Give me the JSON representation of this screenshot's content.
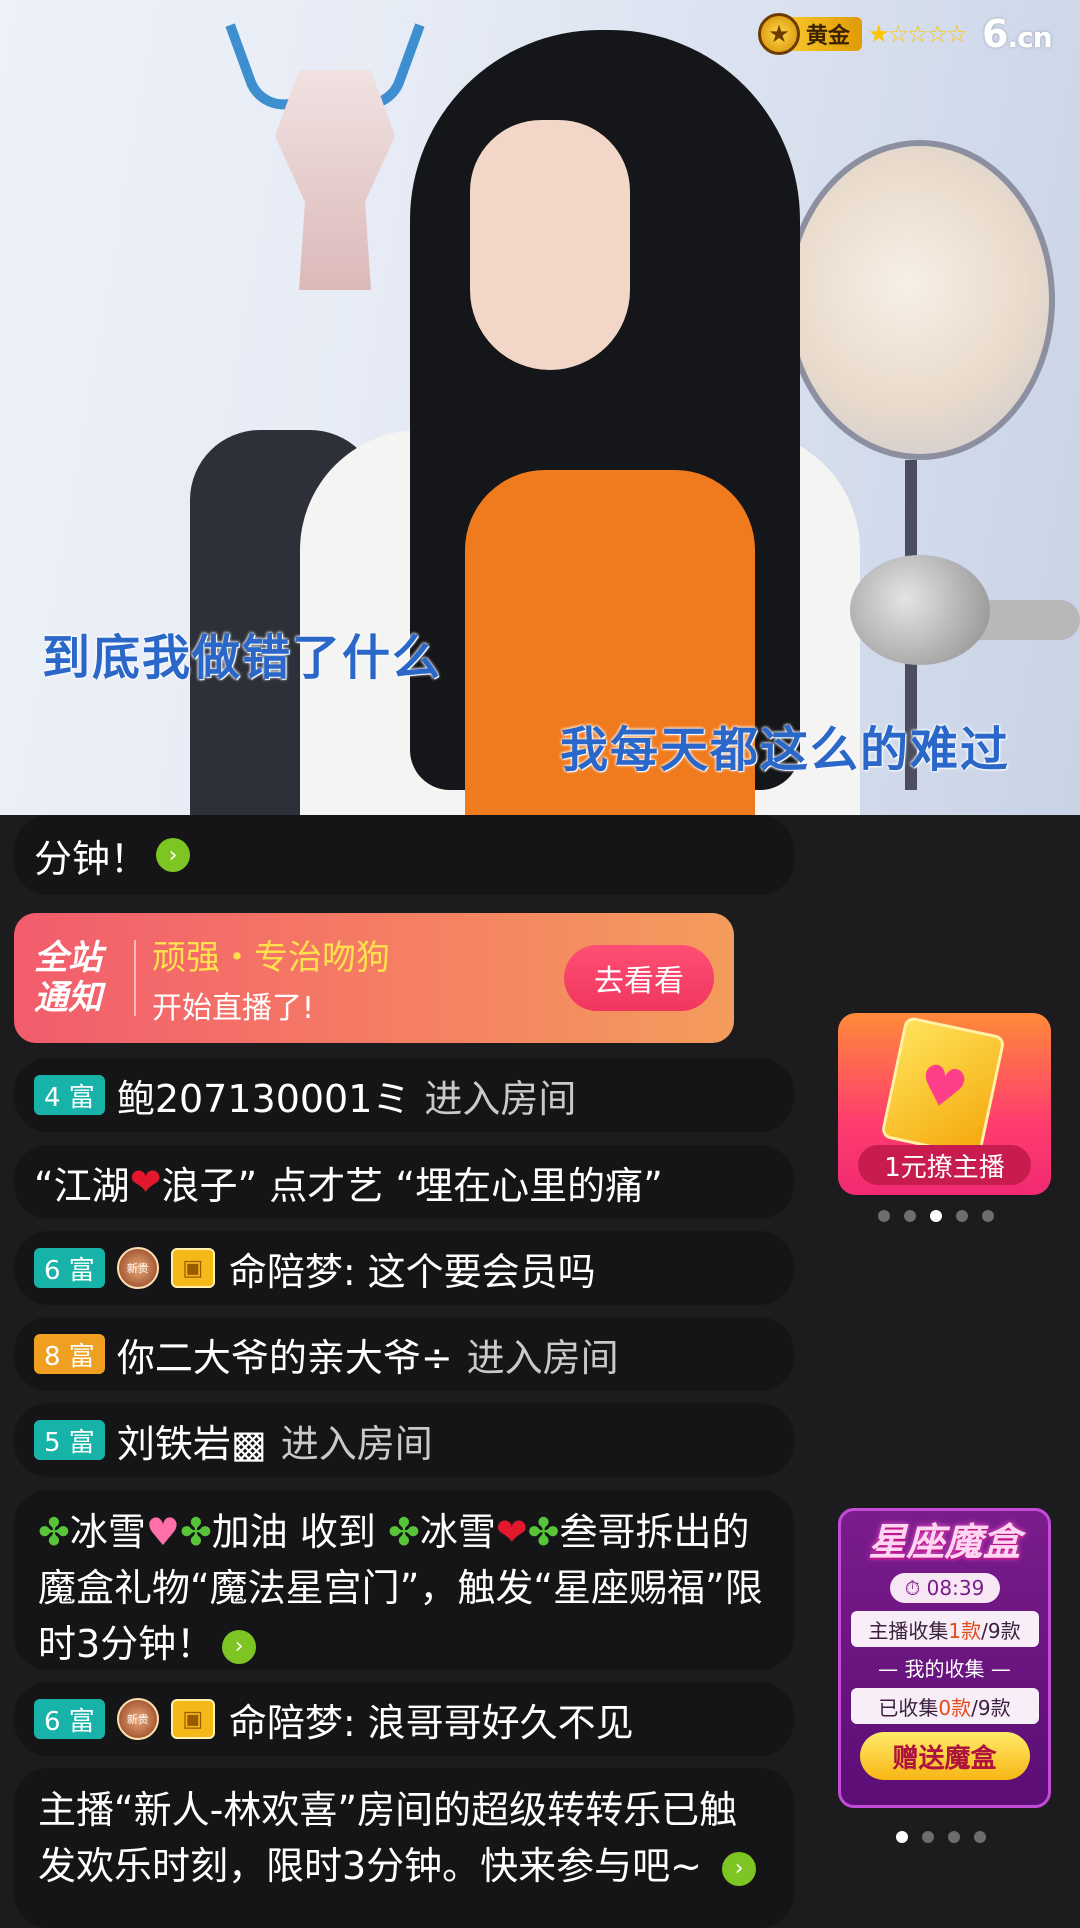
{
  "video": {
    "lyric_line1": "到底我做错了什么",
    "lyric_line2": "我每天都这么的难过"
  },
  "header": {
    "level_label": "黄金",
    "stars": "★☆☆☆☆",
    "logo_main": "6",
    "logo_suffix": ".cn"
  },
  "chat": {
    "top_fragment": "分钟！",
    "notice": {
      "site_label": "全站通知",
      "name": "顽强・专治吻狗",
      "message": "开始直播了!",
      "button": "去看看"
    },
    "msg1": {
      "rank": "4 富",
      "user": "鲍207130001ミ",
      "action": "进入房间"
    },
    "msg2": {
      "q1": "“江湖",
      "q2": "浪子” 点才艺 “埋在心里的痛”"
    },
    "msg3": {
      "rank": "6 富",
      "badge": "新贵",
      "user": "命陪梦:",
      "text": "这个要会员吗"
    },
    "msg4": {
      "rank": "8 富",
      "user": "你二大爷的亲大爷÷",
      "action": "进入房间"
    },
    "msg5": {
      "rank": "5 富",
      "user": "刘铁岩▩",
      "action": "进入房间"
    },
    "msg6": {
      "p1": "冰雪",
      "p2": "加油 收到",
      "p3": "冰雪",
      "p4": "叁哥拆出的魔盒礼物“魔法星宫门”，触发“星座赐福”限时3分钟！"
    },
    "msg7": {
      "rank": "6 富",
      "badge": "新贵",
      "user": "命陪梦:",
      "text": "浪哥哥好久不见"
    },
    "msg8": {
      "text": "主播“新人-林欢喜”房间的超级转转乐已触发欢乐时刻，限时3分钟。快来参与吧~"
    }
  },
  "promo1": {
    "label": "1元撩主播"
  },
  "promo2": {
    "title": "星座魔盒",
    "timer": "08:39",
    "anchor_pre": "主播收集",
    "anchor_count": "1款",
    "anchor_total": "/9款",
    "mine_label": "— 我的收集 —",
    "mine_pre": "已收集",
    "mine_count": "0款",
    "mine_total": "/9款",
    "button": "赠送魔盒"
  }
}
